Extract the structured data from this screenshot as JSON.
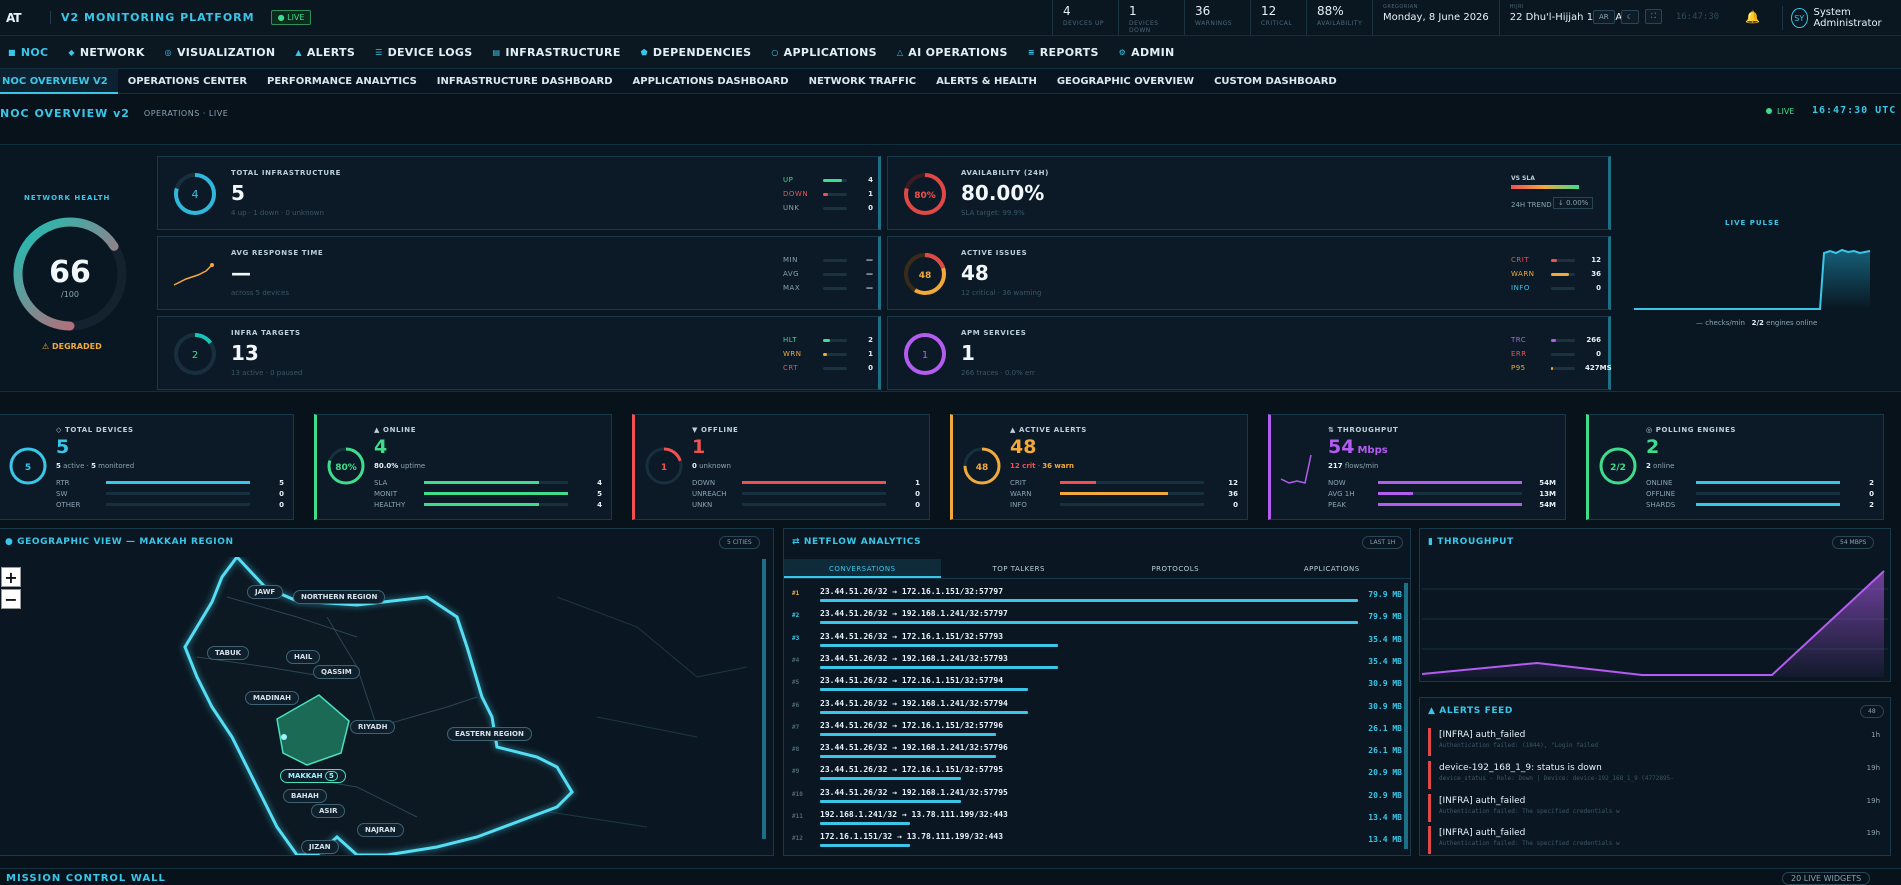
{
  "topbar": {
    "logo": "AT",
    "brand": "V2 MONITORING PLATFORM",
    "live": "● LIVE",
    "counters": [
      {
        "value": "4",
        "label": "DEVICES UP"
      },
      {
        "value": "1",
        "label": "DEVICES DOWN"
      },
      {
        "value": "36",
        "label": "WARNINGS"
      },
      {
        "value": "12",
        "label": "CRITICAL"
      },
      {
        "value": "88%",
        "label": "AVAILABILITY"
      }
    ],
    "gregorian_label": "GREGORIAN",
    "gregorian_date": "Monday, 8 June 2026",
    "hijri_label": "HIJRI",
    "hijri_date": "22 Dhu'l-Hijjah 1447 AH",
    "lang_button": "AR",
    "theme_button": "☾",
    "fullscreen_button": "⛶",
    "clock": "16:47:30",
    "user_initials": "SY",
    "user_name": "System Administrator"
  },
  "nav": [
    {
      "icon": "■",
      "label": "NOC"
    },
    {
      "icon": "◆",
      "label": "NETWORK"
    },
    {
      "icon": "◎",
      "label": "VISUALIZATION"
    },
    {
      "icon": "▲",
      "label": "ALERTS"
    },
    {
      "icon": "☰",
      "label": "DEVICE LOGS"
    },
    {
      "icon": "▤",
      "label": "INFRASTRUCTURE"
    },
    {
      "icon": "⬟",
      "label": "DEPENDENCIES"
    },
    {
      "icon": "○",
      "label": "APPLICATIONS"
    },
    {
      "icon": "△",
      "label": "AI OPERATIONS"
    },
    {
      "icon": "≡",
      "label": "REPORTS"
    },
    {
      "icon": "⚙",
      "label": "ADMIN"
    }
  ],
  "subnav": [
    "NOC OVERVIEW V2",
    "OPERATIONS CENTER",
    "PERFORMANCE ANALYTICS",
    "INFRASTRUCTURE DASHBOARD",
    "APPLICATIONS DASHBOARD",
    "NETWORK TRAFFIC",
    "ALERTS & HEALTH",
    "GEOGRAPHIC OVERVIEW",
    "CUSTOM DASHBOARD"
  ],
  "page": {
    "title": "NOC OVERVIEW v2",
    "subtitle": "OPERATIONS · LIVE",
    "live": "LIVE",
    "clock": "16:47:30 UTC"
  },
  "health": {
    "title": "NETWORK HEALTH",
    "score": "66",
    "max": "/100",
    "score_fraction": 0.66,
    "status": "⚠ DEGRADED"
  },
  "cards": {
    "total_infra": {
      "title": "TOTAL INFRASTRUCTURE",
      "value": "5",
      "ring": "4",
      "sub": "4 up · 1 down · 0 unknown",
      "rows": [
        {
          "k": "UP",
          "n": "4",
          "color": "#3fdc8c",
          "fill": 0.8
        },
        {
          "k": "DOWN",
          "n": "1",
          "color": "#f05050",
          "fill": 0.2
        },
        {
          "k": "UNK",
          "n": "0",
          "color": "#8ca3b2",
          "fill": 0
        }
      ]
    },
    "avg_response": {
      "title": "AVG RESPONSE TIME",
      "value": "—",
      "sub": "across 5 devices",
      "rows": [
        {
          "k": "MIN",
          "n": "—",
          "color": "#8ca3b2"
        },
        {
          "k": "AVG",
          "n": "—",
          "color": "#8ca3b2"
        },
        {
          "k": "MAX",
          "n": "—",
          "color": "#8ca3b2"
        }
      ]
    },
    "infra_targets": {
      "title": "INFRA TARGETS",
      "value": "13",
      "ring": "2",
      "sub": "13 active · 0 paused",
      "rows": [
        {
          "k": "HLT",
          "n": "2",
          "color": "#3fdc8c",
          "fill": 0.3
        },
        {
          "k": "WRN",
          "n": "1",
          "color": "#f2a93b",
          "fill": 0.15
        },
        {
          "k": "CRT",
          "n": "0",
          "color": "#f05050",
          "fill": 0
        }
      ]
    },
    "availability": {
      "title": "AVAILABILITY (24H)",
      "value": "80.00%",
      "ring": "80%",
      "sub": "SLA target: 99.9%",
      "vs_sla": "VS SLA",
      "trend_label": "24H TREND",
      "trend": "↓ 0.00%"
    },
    "active_issues": {
      "title": "ACTIVE ISSUES",
      "value": "48",
      "ring": "48",
      "sub": "12 critical · 36 warning",
      "rows": [
        {
          "k": "CRIT",
          "n": "12",
          "color": "#f05050",
          "fill": 0.25
        },
        {
          "k": "WARN",
          "n": "36",
          "color": "#f2a93b",
          "fill": 0.75
        },
        {
          "k": "INFO",
          "n": "0",
          "color": "#39c6e8",
          "fill": 0
        }
      ]
    },
    "apm": {
      "title": "APM SERVICES",
      "value": "1",
      "ring": "1",
      "sub": "266 traces · 0.0% err",
      "rows": [
        {
          "k": "TRC",
          "n": "266",
          "color": "#b45cf0",
          "fill": 0.2
        },
        {
          "k": "ERR",
          "n": "0",
          "color": "#f05050",
          "fill": 0
        },
        {
          "k": "P95",
          "n": "427MS",
          "color": "#f2a93b",
          "fill": 0.1
        }
      ]
    }
  },
  "pulse": {
    "title": "LIVE PULSE",
    "legend_a": "— checks/min",
    "legend_b_value": "2/2",
    "legend_b": " engines online"
  },
  "kpis": [
    {
      "title": "◇ TOTAL DEVICES",
      "value": "5",
      "ring": "5",
      "color": "#39c6e8",
      "sub_a": "5",
      "sub_b": " active · ",
      "sub_c": "5",
      "sub_d": " monitored",
      "rows": [
        {
          "k": "RTR",
          "n": "5",
          "fill": 1
        },
        {
          "k": "SW",
          "n": "0",
          "fill": 0
        },
        {
          "k": "OTHER",
          "n": "0",
          "fill": 0
        }
      ]
    },
    {
      "title": "▲ ONLINE",
      "value": "4",
      "ring": "80%",
      "color": "#3fdc8c",
      "sub_a": "80.0%",
      "sub_b": " uptime",
      "rows": [
        {
          "k": "SLA",
          "n": "4",
          "fill": 0.8
        },
        {
          "k": "MONIT",
          "n": "5",
          "fill": 1
        },
        {
          "k": "HEALTHY",
          "n": "4",
          "fill": 0.8
        }
      ]
    },
    {
      "title": "▼ OFFLINE",
      "value": "1",
      "ring": "1",
      "color": "#f05050",
      "sub_a": "0",
      "sub_b": " unknown",
      "rows": [
        {
          "k": "DOWN",
          "n": "1",
          "fill": 1
        },
        {
          "k": "UNREACH",
          "n": "0",
          "fill": 0
        },
        {
          "k": "UNKN",
          "n": "0",
          "fill": 0
        }
      ]
    },
    {
      "title": "▲ ACTIVE ALERTS",
      "value": "48",
      "ring": "48",
      "color": "#f2a93b",
      "sub_a": "12 crit",
      "sub_b": " · ",
      "sub_c": "36 warn",
      "rows": [
        {
          "k": "CRIT",
          "n": "12",
          "fill": 0.25
        },
        {
          "k": "WARN",
          "n": "36",
          "fill": 0.75
        },
        {
          "k": "INFO",
          "n": "0",
          "fill": 0
        }
      ]
    },
    {
      "title": "⇅ THROUGHPUT",
      "value": "54",
      "unit": "Mbps",
      "color": "#b45cf0",
      "sub_a": "217",
      "sub_b": " flows/min",
      "rows": [
        {
          "k": "NOW",
          "n": "54M",
          "fill": 1
        },
        {
          "k": "AVG 1H",
          "n": "13M",
          "fill": 0.24
        },
        {
          "k": "PEAK",
          "n": "54M",
          "fill": 1
        }
      ]
    },
    {
      "title": "◎ POLLING ENGINES",
      "value": "2",
      "ring": "2/2",
      "color": "#3fdc8c",
      "sub_a": "2",
      "sub_b": " online",
      "rows": [
        {
          "k": "ONLINE",
          "n": "2",
          "fill": 1
        },
        {
          "k": "OFFLINE",
          "n": "0",
          "fill": 0
        },
        {
          "k": "SHARDS",
          "n": "2",
          "fill": 1
        }
      ]
    }
  ],
  "geo": {
    "title": "● GEOGRAPHIC VIEW — MAKKAH REGION",
    "badge": "5 CITIES",
    "zoom_in": "+",
    "zoom_out": "−",
    "regions": [
      "JAWF",
      "NORTHERN REGION",
      "TABUK",
      "HAIL",
      "QASSIM",
      "MADINAH",
      "RIYADH",
      "EASTERN REGION",
      "MAKKAH",
      "BAHAH",
      "ASIR",
      "NAJRAN",
      "JIZAN"
    ],
    "makkah_count": "5"
  },
  "netflow": {
    "title": "⇄ NETFLOW ANALYTICS",
    "badge": "LAST 1H",
    "tabs": [
      "CONVERSATIONS",
      "TOP TALKERS",
      "PROTOCOLS",
      "APPLICATIONS"
    ],
    "rows": [
      {
        "rank": "#1",
        "pair": "23.44.51.26/32 → 172.16.1.151/32:57797",
        "size": "79.9 MB",
        "mb": 79.9
      },
      {
        "rank": "#2",
        "pair": "23.44.51.26/32 → 192.168.1.241/32:57797",
        "size": "79.9 MB",
        "mb": 79.9
      },
      {
        "rank": "#3",
        "pair": "23.44.51.26/32 → 172.16.1.151/32:57793",
        "size": "35.4 MB",
        "mb": 35.4
      },
      {
        "rank": "#4",
        "pair": "23.44.51.26/32 → 192.168.1.241/32:57793",
        "size": "35.4 MB",
        "mb": 35.4
      },
      {
        "rank": "#5",
        "pair": "23.44.51.26/32 → 172.16.1.151/32:57794",
        "size": "30.9 MB",
        "mb": 30.9
      },
      {
        "rank": "#6",
        "pair": "23.44.51.26/32 → 192.168.1.241/32:57794",
        "size": "30.9 MB",
        "mb": 30.9
      },
      {
        "rank": "#7",
        "pair": "23.44.51.26/32 → 172.16.1.151/32:57796",
        "size": "26.1 MB",
        "mb": 26.1
      },
      {
        "rank": "#8",
        "pair": "23.44.51.26/32 → 192.168.1.241/32:57796",
        "size": "26.1 MB",
        "mb": 26.1
      },
      {
        "rank": "#9",
        "pair": "23.44.51.26/32 → 172.16.1.151/32:57795",
        "size": "20.9 MB",
        "mb": 20.9
      },
      {
        "rank": "#10",
        "pair": "23.44.51.26/32 → 192.168.1.241/32:57795",
        "size": "20.9 MB",
        "mb": 20.9
      },
      {
        "rank": "#11",
        "pair": "192.168.1.241/32 → 13.78.111.199/32:443",
        "size": "13.4 MB",
        "mb": 13.4
      },
      {
        "rank": "#12",
        "pair": "172.16.1.151/32 → 13.78.111.199/32:443",
        "size": "13.4 MB",
        "mb": 13.4
      }
    ]
  },
  "throughput": {
    "title": "▮ THROUGHPUT",
    "badge": "54 MBPS"
  },
  "alerts": {
    "title": "▲ ALERTS FEED",
    "badge": "48",
    "items": [
      {
        "title": "[INFRA] auth_failed",
        "detail": "Authentication failed: (1844), \"Login failed",
        "age": "1h"
      },
      {
        "title": "device-192_168_1_9: status is down",
        "detail": "device_status - Role: Down | Device: device-192_168_1_9 (4772895-",
        "age": "19h"
      },
      {
        "title": "[INFRA] auth_failed",
        "detail": "Authentication failed: The specified credentials w",
        "age": "19h"
      },
      {
        "title": "[INFRA] auth_failed",
        "detail": "Authentication failed: The specified credentials w",
        "age": "19h"
      }
    ]
  },
  "wall": {
    "title": "MISSION CONTROL WALL",
    "badge": "20 LIVE WIDGETS"
  }
}
